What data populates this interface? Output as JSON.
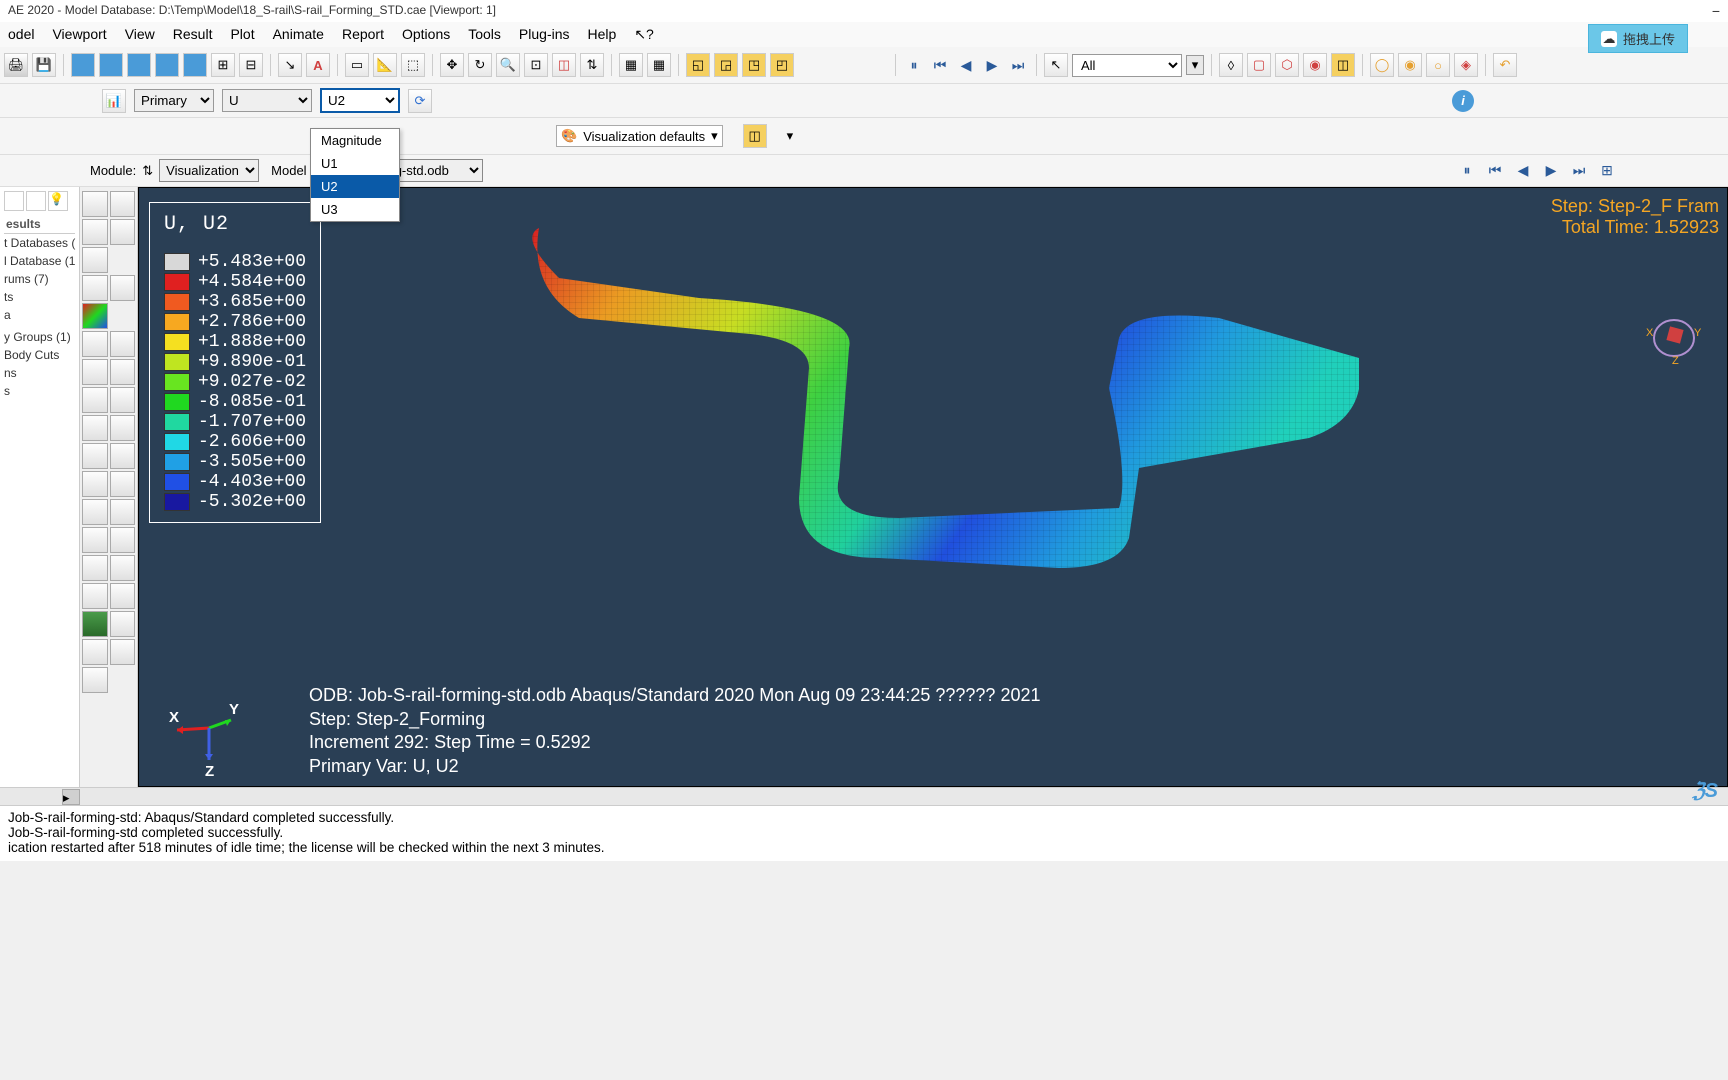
{
  "titlebar": "AE 2020 - Model Database: D:\\Temp\\Model\\18_S-rail\\S-rail_Forming_STD.cae [Viewport: 1]",
  "menu": {
    "model": "odel",
    "viewport": "Viewport",
    "view": "View",
    "result": "Result",
    "plot": "Plot",
    "animate": "Animate",
    "report": "Report",
    "options": "Options",
    "tools": "Tools",
    "plugins": "Plug-ins",
    "help": "Help",
    "cursor": "↖?"
  },
  "upload": {
    "label": "拖拽上传"
  },
  "toolbar1": {
    "allLabel": "All"
  },
  "fieldBar": {
    "primary": "Primary",
    "variable": "U",
    "component": "U2"
  },
  "componentDropdown": {
    "items": [
      "Magnitude",
      "U1",
      "U2",
      "U3"
    ],
    "selected": "U2"
  },
  "vizDefaults": "Visualization defaults",
  "moduleBar": {
    "moduleLabel": "Module:",
    "module": "Visualization",
    "modelLabel": "Model",
    "odb": "-S-rail-forming-std.odb"
  },
  "tree": {
    "tab": "esults",
    "items": [
      "t Databases (",
      "l Database (1",
      "rums (7)",
      "ts",
      "a",
      "",
      "y Groups (1)",
      "Body Cuts",
      "ns",
      "s"
    ]
  },
  "legend": {
    "title": "U, U2",
    "colors": [
      "#d8d8d8",
      "#e02020",
      "#f05a20",
      "#f7a820",
      "#f5e020",
      "#bfe520",
      "#68e520",
      "#20d820",
      "#20d8a0",
      "#20d8e5",
      "#20a0e5",
      "#2050e5",
      "#1818a0"
    ],
    "values": [
      "+5.483e+00",
      "+4.584e+00",
      "+3.685e+00",
      "+2.786e+00",
      "+1.888e+00",
      "+9.890e-01",
      "+9.027e-02",
      "-8.085e-01",
      "-1.707e+00",
      "-2.606e+00",
      "-3.505e+00",
      "-4.403e+00",
      "-5.302e+00"
    ]
  },
  "stepInfo": {
    "line1": "Step: Step-2_F Fram",
    "line2": "Total Time: 1.52923"
  },
  "bottomInfo": {
    "odb": "ODB: Job-S-rail-forming-std.odb    Abaqus/Standard 2020    Mon Aug 09 23:44:25 ?????? 2021",
    "step": "Step: Step-2_Forming",
    "inc": "Increment   292: Step Time =   0.5292",
    "var": "Primary Var: U, U2"
  },
  "axes": {
    "x": "X",
    "y": "Y",
    "z": "Z"
  },
  "console": {
    "l1": "Job-S-rail-forming-std: Abaqus/Standard completed successfully.",
    "l2": "Job-S-rail-forming-std completed successfully.",
    "l3": "ication restarted after 518 minutes of idle time; the license will be checked within the next 3 minutes."
  }
}
